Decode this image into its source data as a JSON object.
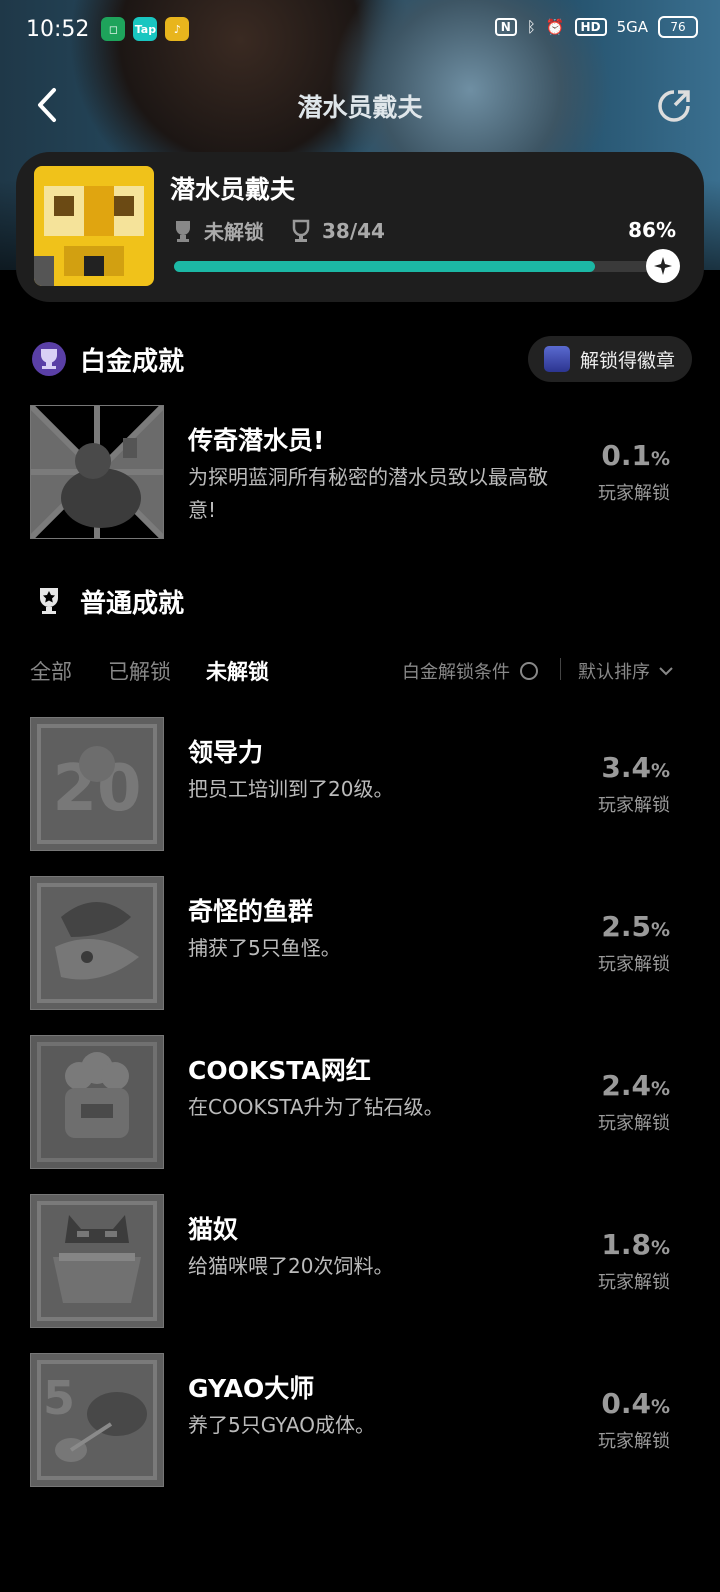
{
  "status_bar": {
    "time": "10:52",
    "app_icon_tap": "Tap",
    "net": "5GA",
    "battery": "76"
  },
  "nav": {
    "title": "潜水员戴夫"
  },
  "game": {
    "title": "潜水员戴夫",
    "lock_status": "未解锁",
    "trophy_count": "38/44",
    "progress_percent": "86%",
    "progress_value": 0.86
  },
  "platinum": {
    "heading": "白金成就",
    "badge_button": "解锁得徽章",
    "item": {
      "title": "传奇潜水员!",
      "desc": "为探明蓝洞所有秘密的潜水员致以最高敬意!",
      "value": "0.1",
      "unit": "%",
      "label": "玩家解锁"
    }
  },
  "normal": {
    "heading": "普通成就",
    "tabs": [
      "全部",
      "已解锁",
      "未解锁"
    ],
    "active_tab": "未解锁",
    "condition": "白金解锁条件",
    "sort": "默认排序",
    "items": [
      {
        "title": "领导力",
        "desc": "把员工培训到了20级。",
        "value": "3.4",
        "unit": "%",
        "label": "玩家解锁"
      },
      {
        "title": "奇怪的鱼群",
        "desc": "捕获了5只鱼怪。",
        "value": "2.5",
        "unit": "%",
        "label": "玩家解锁"
      },
      {
        "title": "COOKSTA网红",
        "desc": "在COOKSTA升为了钻石级。",
        "value": "2.4",
        "unit": "%",
        "label": "玩家解锁"
      },
      {
        "title": "猫奴",
        "desc": "给猫咪喂了20次饲料。",
        "value": "1.8",
        "unit": "%",
        "label": "玩家解锁"
      },
      {
        "title": "GYAO大师",
        "desc": "养了5只GYAO成体。",
        "value": "0.4",
        "unit": "%",
        "label": "玩家解锁"
      }
    ]
  }
}
